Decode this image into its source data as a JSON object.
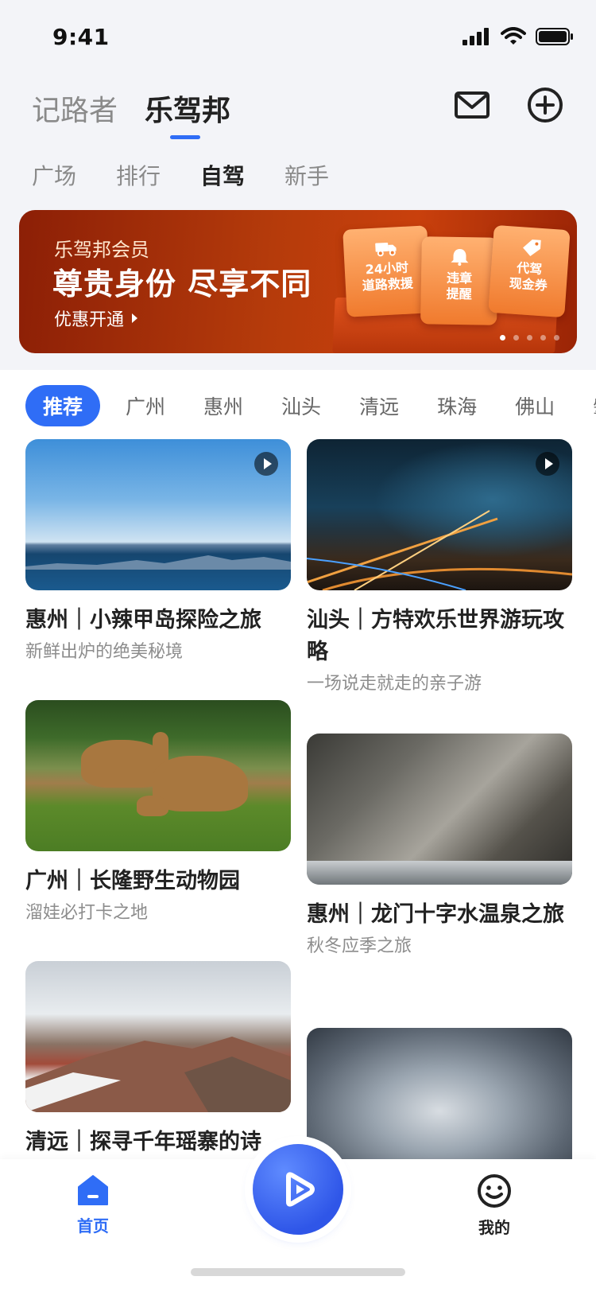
{
  "status_bar": {
    "time": "9:41"
  },
  "header": {
    "tabs": [
      {
        "label": "记路者"
      },
      {
        "label": "乐驾邦"
      }
    ]
  },
  "sub_tabs": [
    {
      "label": "广场"
    },
    {
      "label": "排行"
    },
    {
      "label": "自驾"
    },
    {
      "label": "新手"
    }
  ],
  "banner": {
    "subtitle": "乐驾邦会员",
    "title": "尊贵身份 尽享不同",
    "cta": "优惠开通",
    "coupons": [
      {
        "line1": "24小时",
        "line2": "道路救援",
        "icon": "truck-icon"
      },
      {
        "line1": "违章",
        "line2": "提醒",
        "icon": "bell-icon"
      },
      {
        "line1": "代驾",
        "line2": "现金券",
        "icon": "tag-icon"
      }
    ]
  },
  "city_chips": [
    "推荐",
    "广州",
    "惠州",
    "汕头",
    "清远",
    "珠海",
    "佛山",
    "肇"
  ],
  "cards": [
    {
      "title": "惠州｜小辣甲岛探险之旅",
      "subtitle": "新鲜出炉的绝美秘境"
    },
    {
      "title": "汕头｜方特欢乐世界游玩攻略",
      "subtitle": "一场说走就走的亲子游"
    },
    {
      "title": "广州｜长隆野生动物园",
      "subtitle": "溜娃必打卡之地"
    },
    {
      "title": "惠州｜龙门十字水温泉之旅",
      "subtitle": "秋冬应季之旅"
    },
    {
      "title": "清远｜探寻千年瑶寨的诗",
      "subtitle": ""
    }
  ],
  "bottom_nav": {
    "home_label": "首页",
    "me_label": "我的"
  },
  "colors": {
    "accent": "#2f6df6",
    "banner": "#b53b0b"
  }
}
